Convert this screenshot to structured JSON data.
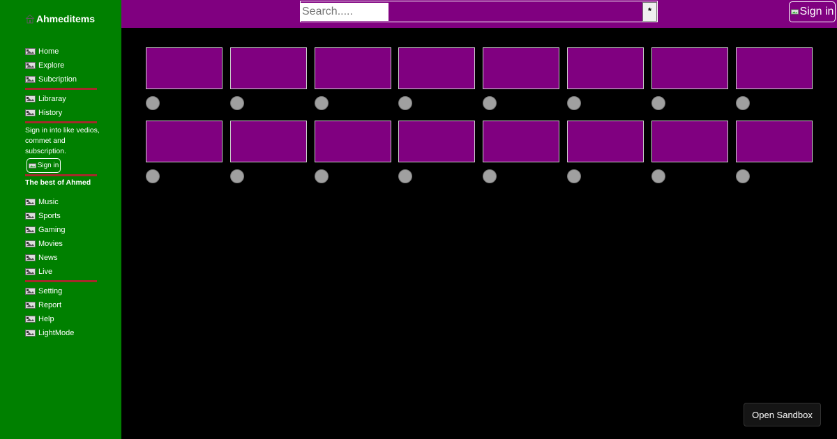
{
  "sidebar": {
    "brand": "Ahmeditems",
    "nav_group_1": [
      {
        "label": "Home",
        "icon": "image-icon"
      },
      {
        "label": "Explore",
        "icon": "image-icon"
      },
      {
        "label": "Subcription",
        "icon": "image-icon"
      }
    ],
    "nav_group_2": [
      {
        "label": "Libraray",
        "icon": "image-icon"
      },
      {
        "label": "History",
        "icon": "image-icon"
      }
    ],
    "signin_prompt": "Sign in into like vedios, commet and subscription.",
    "signin_label": "Sign in",
    "section_title": "The best of Ahmed",
    "nav_group_3": [
      {
        "label": "Music",
        "icon": "image-icon"
      },
      {
        "label": "Sports",
        "icon": "image-icon"
      },
      {
        "label": "Gaming",
        "icon": "image-icon"
      },
      {
        "label": "Movies",
        "icon": "image-icon"
      },
      {
        "label": "News",
        "icon": "image-icon"
      },
      {
        "label": "Live",
        "icon": "image-icon"
      }
    ],
    "nav_group_4": [
      {
        "label": "Setting",
        "icon": "image-icon"
      },
      {
        "label": "Report",
        "icon": "image-icon"
      },
      {
        "label": "Help",
        "icon": "image-icon"
      },
      {
        "label": "LightMode",
        "icon": "image-icon"
      }
    ]
  },
  "header": {
    "search_placeholder": "Search.....",
    "search_value": "",
    "search_button": "*",
    "signin_label": "Sign in"
  },
  "grid": {
    "rows": 2,
    "columns": 8
  },
  "sandbox_button": "Open Sandbox",
  "colors": {
    "sidebar": "#008000",
    "header": "#800080",
    "thumbnail": "#800080",
    "divider": "#a52a2a",
    "background": "#000000"
  }
}
